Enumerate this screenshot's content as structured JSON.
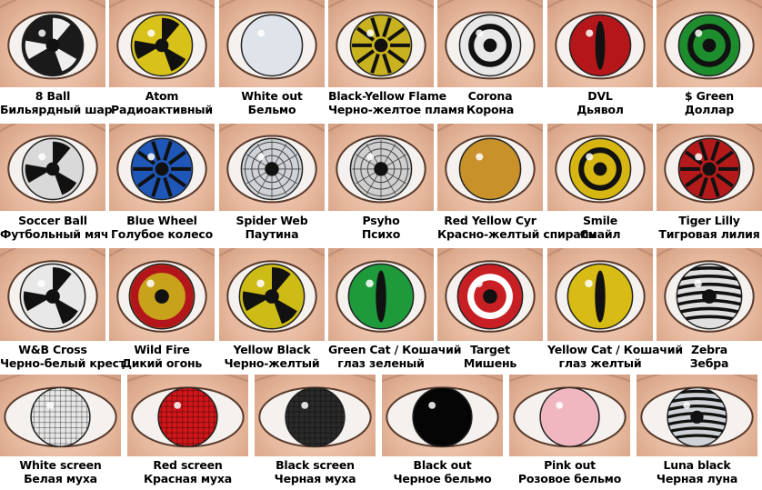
{
  "items": [
    {
      "en": "8 Ball",
      "ru": "Бильярдный шар",
      "iris": "#1a1a1a",
      "pattern": "ball"
    },
    {
      "en": "Atom",
      "ru": "Радиоактивный",
      "iris": "#d8c21a",
      "pattern": "atom"
    },
    {
      "en": "White out",
      "ru": "Бельмо",
      "iris": "#dfe3ea",
      "pattern": "plain"
    },
    {
      "en": "Black-Yellow Flame",
      "ru": "Черно-желтое пламя",
      "iris": "#c9b21f",
      "pattern": "flame"
    },
    {
      "en": "Corona",
      "ru": "Корона",
      "iris": "#e8e8e8",
      "pattern": "ring"
    },
    {
      "en": "DVL",
      "ru": "Дьявол",
      "iris": "#b5161a",
      "pattern": "cat"
    },
    {
      "en": "$ Green",
      "ru": "Доллар",
      "iris": "#1e8d2e",
      "pattern": "ring"
    },
    {
      "en": "Soccer Ball",
      "ru": "Футбольный мяч",
      "iris": "#d9d9d9",
      "pattern": "ball"
    },
    {
      "en": "Blue Wheel",
      "ru": "Голубое колесо",
      "iris": "#1e57b8",
      "pattern": "spokes"
    },
    {
      "en": "Spider Web",
      "ru": "Паутина",
      "iris": "#cfd2d6",
      "pattern": "web"
    },
    {
      "en": "Psyho",
      "ru": "Психо",
      "iris": "#cfcfcf",
      "pattern": "spiral"
    },
    {
      "en": "Red Yellow Cyr",
      "ru": "Красно-желтый спираль",
      "iris": "#c9912a",
      "pattern": "plain"
    },
    {
      "en": "Smile",
      "ru": "Смайл",
      "iris": "#d7b611",
      "pattern": "ring"
    },
    {
      "en": "Tiger Lilly",
      "ru": "Тигровая лилия",
      "iris": "#b51a1a",
      "pattern": "spokes"
    },
    {
      "en": "W&B Cross",
      "ru": "Черно-белый крест",
      "iris": "#e8e8e8",
      "pattern": "cross"
    },
    {
      "en": "Wild Fire",
      "ru": "Дикий огонь",
      "iris": "#c9a21c",
      "pattern": "ring-red"
    },
    {
      "en": "Yellow Black",
      "ru": "Черно-желтый",
      "iris": "#cdbb16",
      "pattern": "atom"
    },
    {
      "en": "Green Cat / Кошачий",
      "ru": "глаз зеленый",
      "iris": "#1e9a3a",
      "pattern": "cat"
    },
    {
      "en": "Target",
      "ru": "Мишень",
      "iris": "#c71f24",
      "pattern": "target"
    },
    {
      "en": "Yellow Cat / Кошачий",
      "ru": "глаз желтый",
      "iris": "#d8bb14",
      "pattern": "cat"
    },
    {
      "en": "Zebra",
      "ru": "Зебра",
      "iris": "#e0e0e0",
      "pattern": "zebra"
    },
    {
      "en": "White screen",
      "ru": "Белая муха",
      "iris": "#e6e6e6",
      "pattern": "mesh"
    },
    {
      "en": "Red screen",
      "ru": "Красная муха",
      "iris": "#d0161a",
      "pattern": "mesh"
    },
    {
      "en": "Black screen",
      "ru": "Черная муха",
      "iris": "#2a2a2a",
      "pattern": "mesh"
    },
    {
      "en": "Black out",
      "ru": "Черное бельмо",
      "iris": "#050505",
      "pattern": "plain"
    },
    {
      "en": "Pink out",
      "ru": "Розовое бельмо",
      "iris": "#f1b7c1",
      "pattern": "plain"
    },
    {
      "en": "Luna black",
      "ru": "Черная луна",
      "iris": "#cfd2d6",
      "pattern": "zebra"
    }
  ]
}
